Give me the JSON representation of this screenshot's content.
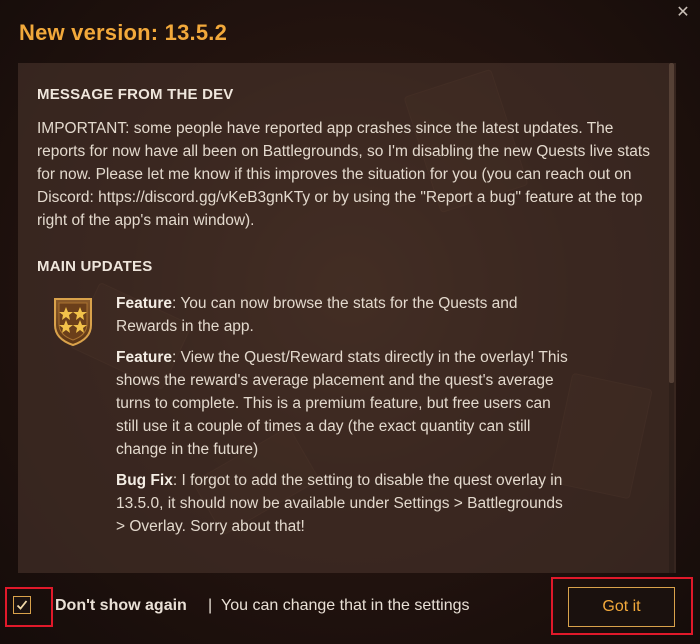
{
  "dialog": {
    "title": "New version: 13.5.2",
    "close_icon": "close-icon"
  },
  "content": {
    "dev_message": {
      "heading": "MESSAGE FROM THE DEV",
      "body": "IMPORTANT: some people have reported app crashes since the latest updates. The reports for now have all been on Battlegrounds, so I'm disabling the new Quests live stats for now. Please let me know if this improves the situation for you (you can reach out on Discord: https://discord.gg/vKeB3gnKTy or by using the \"Report a bug\" feature at the top right of the app's main window)."
    },
    "main_updates": {
      "heading": "MAIN UPDATES",
      "icon": "battlegrounds-badge-icon",
      "items": [
        {
          "label": "Feature",
          "text": ": You can now browse the stats for the Quests and Rewards in the app."
        },
        {
          "label": "Feature",
          "text": ": View the Quest/Reward stats directly in the overlay! This shows the reward's average placement and the quest's average turns to complete. This is a premium feature, but free users can still use it a couple of times a day (the exact quantity can still change in the future)"
        },
        {
          "label": "Bug Fix",
          "text": ": I forgot to add the setting to disable the quest overlay in 13.5.0, it should now be available under Settings > Battlegrounds > Overlay. Sorry about that!"
        }
      ]
    }
  },
  "footer": {
    "checkbox_checked": true,
    "dont_show_label": "Don't show again",
    "separator": "|",
    "hint": "You can change that in the settings",
    "got_it_label": "Got it"
  },
  "colors": {
    "accent": "#f2a93b",
    "highlight_frame": "#e0192a",
    "panel": "#48342c"
  }
}
